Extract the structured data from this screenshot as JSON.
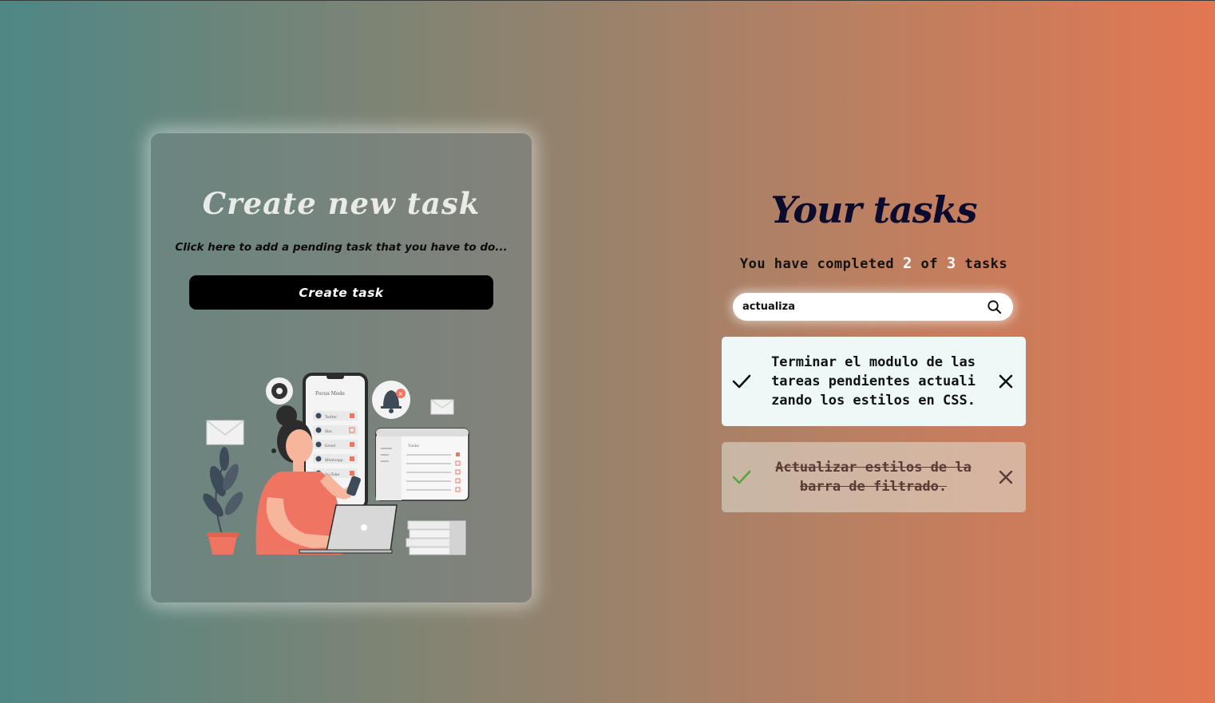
{
  "create": {
    "title": "Create new task",
    "subtitle": "Click here to add a pending task that you have to do...",
    "button_label": "Create task"
  },
  "illustration": {
    "phone_header": "Focus Mode",
    "phone_apps": [
      "Twitter",
      "Slac",
      "Gmail",
      "Whatsapp",
      "YouTube"
    ],
    "panel_title": "Tasks"
  },
  "tasks": {
    "title": "Your tasks",
    "counter_prefix": "You have completed",
    "completed": "2",
    "counter_of": "of",
    "total": "3",
    "counter_suffix": "tasks",
    "search_value": "actualiza",
    "items": [
      {
        "text": "Terminar el modulo de las tareas pendientes actualizando los estilos en CSS.",
        "completed": false
      },
      {
        "text": "Actualizar estilos de la barra de filtrado.",
        "completed": true
      }
    ]
  },
  "colors": {
    "gradient_left": "#4f8785",
    "gradient_right": "#e27752",
    "title_dark": "#0b0b2e",
    "check_done": "#5aa33a",
    "accent_red": "#f07462"
  }
}
